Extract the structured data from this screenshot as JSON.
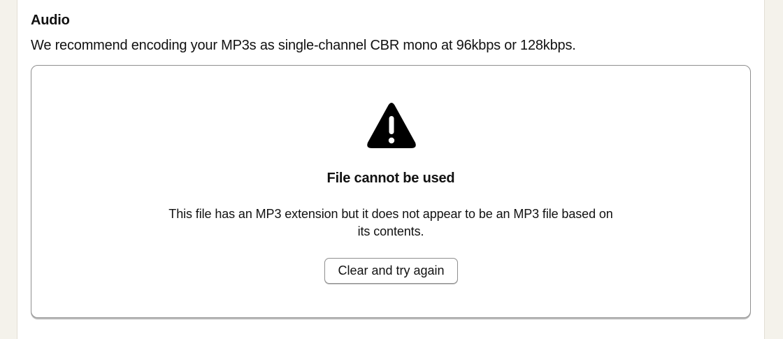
{
  "audio_section": {
    "title": "Audio",
    "description": "We recommend encoding your MP3s as single-channel CBR mono at 96kbps or 128kbps."
  },
  "upload_error": {
    "icon": "warning-triangle-icon",
    "title": "File cannot be used",
    "message": "This file has an MP3 extension but it does not appear to be an MP3 file based on its contents.",
    "retry_label": "Clear and try again"
  },
  "colors": {
    "page_background": "#f4f2eb",
    "panel_background": "#ffffff",
    "text": "#111111",
    "border": "#8f8f8f"
  }
}
